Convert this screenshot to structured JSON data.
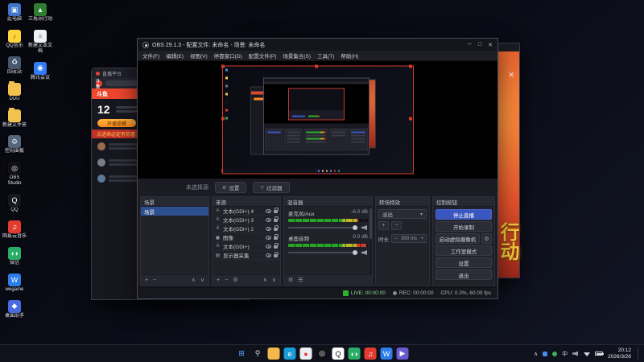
{
  "colors": {
    "accent_blue": "#3a57c0",
    "live_green": "#2fae2f",
    "brand_red": "#e0422f"
  },
  "icons": {
    "add": "+",
    "remove": "−",
    "gear": "⚙",
    "up": "∧",
    "down": "∨",
    "caret": "▾",
    "close": "✕",
    "min": "─",
    "max": "□",
    "filter": "▽",
    "burger": "☰",
    "chevron_up": "∧"
  },
  "desktop": {
    "icons_col1": [
      {
        "name": "desktop-icon-this-pc",
        "label": "此电脑",
        "glyph": "▣",
        "bg": "#3f74c9",
        "fg": "#eaf2ff"
      },
      {
        "name": "desktop-icon-qq-music",
        "label": "QQ音乐",
        "glyph": "♪",
        "bg": "#ffd43b",
        "fg": "#7a5200"
      },
      {
        "name": "desktop-icon-recycle-bin",
        "label": "回收站",
        "glyph": "♻",
        "bg": "#47566a",
        "fg": "#dfe9f5"
      },
      {
        "name": "desktop-icon-ddu-folder",
        "label": "DDU",
        "glyph": "",
        "bg": "#f2c14e",
        "fg": "#b07c1a",
        "is_folder": true
      },
      {
        "name": "desktop-icon-new-folder",
        "label": "新建文件夹",
        "glyph": "",
        "bg": "#f2c14e",
        "fg": "#b07c1a",
        "is_folder": true
      },
      {
        "name": "desktop-icon-control-panel",
        "label": "控制面板",
        "glyph": "⚙",
        "bg": "#55657a",
        "fg": "#e8eef7"
      },
      {
        "name": "desktop-icon-obs-studio",
        "label": "OBS Studio",
        "glyph": "◎",
        "bg": "#101016",
        "fg": "#ffffff"
      },
      {
        "name": "desktop-icon-qq",
        "label": "QQ",
        "glyph": "Q",
        "bg": "#15181d",
        "fg": "#ffffff"
      },
      {
        "name": "desktop-icon-netease-music",
        "label": "网易云音乐",
        "glyph": "♫",
        "bg": "#e23b2f",
        "fg": "#ffffff"
      },
      {
        "name": "desktop-icon-wechat",
        "label": "微信",
        "glyph": "◖◗",
        "bg": "#2aae67",
        "fg": "#ffffff"
      },
      {
        "name": "desktop-icon-wegame",
        "label": "wegame",
        "glyph": "W",
        "bg": "#2b7de9",
        "fg": "#ffffff"
      },
      {
        "name": "desktop-icon-desktop-assistant",
        "label": "桌面助手",
        "glyph": "◆",
        "bg": "#4a6adf",
        "fg": "#ffffff"
      }
    ],
    "icons_col2": [
      {
        "name": "desktop-icon-delta-force",
        "label": "三角洲行动",
        "glyph": "▲",
        "bg": "#2e7d32",
        "fg": "#d9f2d9"
      },
      {
        "name": "desktop-icon-new-text-doc",
        "label": "新建文本文档",
        "glyph": "≡",
        "bg": "#eef0f4",
        "fg": "#8a93a3"
      },
      {
        "name": "desktop-icon-tencent-meeting",
        "label": "腾讯会议",
        "glyph": "◉",
        "bg": "#2f7cf6",
        "fg": "#ffffff"
      }
    ]
  },
  "browser_window": {
    "title": "直播平台",
    "brand": "斗鱼",
    "stat_number": "12",
    "action_label": "开播提醒",
    "banner_text": "点进来必定有惊喜"
  },
  "game_window": {
    "art_text": "行动"
  },
  "obs": {
    "window_title": "OBS 29.1.3 - 配置文件: 未命名 - 场景: 未命名",
    "menu": [
      "文件(F)",
      "编辑(E)",
      "视图(V)",
      "停靠窗口(D)",
      "配置文件(P)",
      "场景集合(S)",
      "工具(T)",
      "帮助(H)"
    ],
    "context_bar": {
      "no_source": "未选择源",
      "settings": "设置",
      "filters": "过滤器"
    },
    "scenes": {
      "title": "场景",
      "items": [
        {
          "label": "场景",
          "selected": true
        }
      ]
    },
    "sources": {
      "title": "来源",
      "items": [
        {
          "icon": "A",
          "label": "文本(GDI+) 4"
        },
        {
          "icon": "A",
          "label": "文本(GDI+) 3"
        },
        {
          "icon": "A",
          "label": "文本(GDI+) 2"
        },
        {
          "icon": "▣",
          "label": "图像"
        },
        {
          "icon": "A",
          "label": "文本(GDI+)"
        },
        {
          "icon": "▤",
          "label": "显示器采集"
        }
      ]
    },
    "mixer": {
      "title": "混音器",
      "channels": [
        {
          "name": "麦克风/Aux",
          "db": "-6.0 dB",
          "cover_pct": "12%"
        },
        {
          "name": "桌面音频",
          "db": "0.0 dB",
          "cover_pct": "2%"
        }
      ]
    },
    "transitions": {
      "title": "转场特效",
      "selected": "淡出",
      "duration_label": "时长",
      "duration_value": "300 ms"
    },
    "controls": {
      "title": "控制按钮",
      "buttons": [
        {
          "name": "stop-streaming-button",
          "label": "停止直播",
          "active": true
        },
        {
          "name": "start-recording-button",
          "label": "开始录制"
        },
        {
          "name": "start-virtualcam-button",
          "label": "启动虚拟摄像机",
          "gear": true
        },
        {
          "name": "studio-mode-button",
          "label": "工作室模式"
        },
        {
          "name": "settings-button",
          "label": "设置"
        },
        {
          "name": "exit-button",
          "label": "退出"
        }
      ]
    },
    "status_bar": {
      "live": "LIVE: 00:00:00",
      "rec": "REC: 00:00:00",
      "stats": "CPU: 0.3%, 60.00 fps"
    }
  },
  "taskbar": {
    "icons": [
      {
        "name": "taskbar-start-button",
        "glyph": "⊞",
        "bg": "transparent",
        "fg": "#5aa2ff"
      },
      {
        "name": "taskbar-search-button",
        "glyph": "⚲",
        "bg": "transparent",
        "fg": "#d8dce6"
      },
      {
        "name": "taskbar-explorer-icon",
        "glyph": "",
        "bg": "#f2b84b",
        "fg": "#ffffff",
        "is_folder": true
      },
      {
        "name": "taskbar-edge-icon",
        "glyph": "e",
        "bg": "#1a9cd8",
        "fg": "#ffffff"
      },
      {
        "name": "taskbar-browser-icon",
        "glyph": "●",
        "bg": "#eceef4",
        "fg": "#e23b2f"
      },
      {
        "name": "taskbar-obs-icon",
        "glyph": "◎",
        "bg": "#0f0f14",
        "fg": "#ffffff"
      },
      {
        "name": "taskbar-qq-icon",
        "glyph": "Q",
        "bg": "#ffffff",
        "fg": "#1a1a1a"
      },
      {
        "name": "taskbar-wechat-icon",
        "glyph": "◖◗",
        "bg": "#2aae67",
        "fg": "#ffffff"
      },
      {
        "name": "taskbar-netease-music-icon",
        "glyph": "♫",
        "bg": "#e23b2f",
        "fg": "#ffffff"
      },
      {
        "name": "taskbar-wegame-icon",
        "glyph": "W",
        "bg": "#2b7de9",
        "fg": "#ffffff"
      },
      {
        "name": "taskbar-video-icon",
        "glyph": "▶",
        "bg": "#6a5acd",
        "fg": "#ffffff"
      }
    ],
    "tray": {
      "ime": "中",
      "time": "20:12",
      "date": "2026/3/26"
    }
  }
}
